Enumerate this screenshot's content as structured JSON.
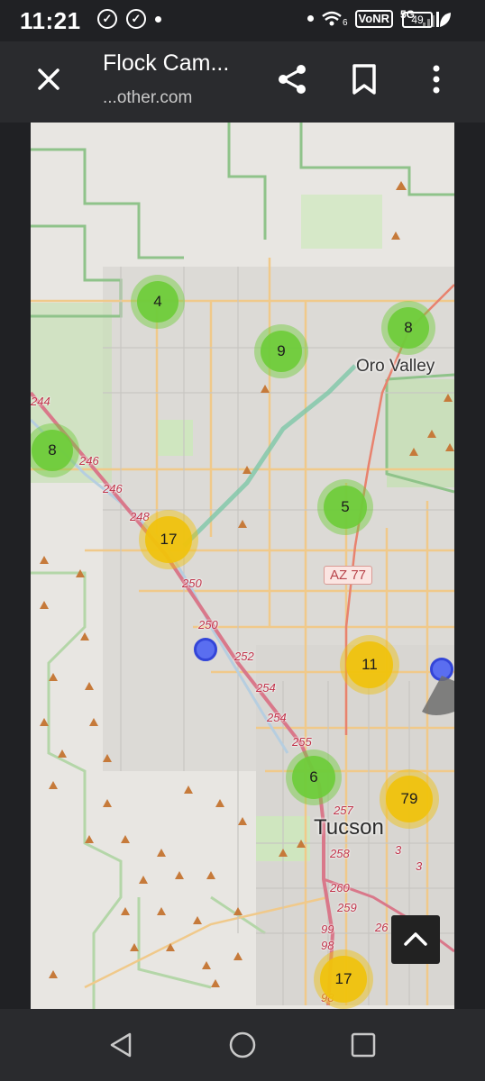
{
  "status_bar": {
    "time": "11:21",
    "network": "VoNR",
    "network_gen": "5G",
    "wifi_badge": "6",
    "battery": "49",
    "icons": [
      "check-circle-icon",
      "check-circle-icon",
      "dot-icon",
      "dot-icon",
      "wifi-icon",
      "signal-icon",
      "battery-icon",
      "leaf-icon"
    ]
  },
  "toolbar": {
    "title": "Flock Cam...",
    "url": "...other.com",
    "icons": [
      "close-icon",
      "share-icon",
      "bookmark-icon",
      "more-vert-icon"
    ]
  },
  "map": {
    "clusters": [
      {
        "count": "4",
        "color": "green"
      },
      {
        "count": "9",
        "color": "green"
      },
      {
        "count": "8",
        "color": "green"
      },
      {
        "count": "8",
        "color": "green"
      },
      {
        "count": "17",
        "color": "yellow"
      },
      {
        "count": "5",
        "color": "green"
      },
      {
        "count": "11",
        "color": "yellow"
      },
      {
        "count": "6",
        "color": "green"
      },
      {
        "count": "79",
        "color": "yellow"
      },
      {
        "count": "17",
        "color": "yellow"
      }
    ],
    "places": {
      "oro_valley": "Oro Valley",
      "tucson": "Tucson"
    },
    "route_shield": "AZ 77",
    "mile_markers": [
      "244",
      "246",
      "246",
      "248",
      "250",
      "250",
      "251",
      "252",
      "254",
      "254",
      "255",
      "257",
      "258",
      "260",
      "259",
      "26",
      "99",
      "98",
      "98",
      "3",
      "3"
    ]
  },
  "scroll_top_icon": "chevron-up-icon",
  "nav_bar": {
    "icons": [
      "back-icon",
      "home-icon",
      "recents-icon"
    ]
  }
}
